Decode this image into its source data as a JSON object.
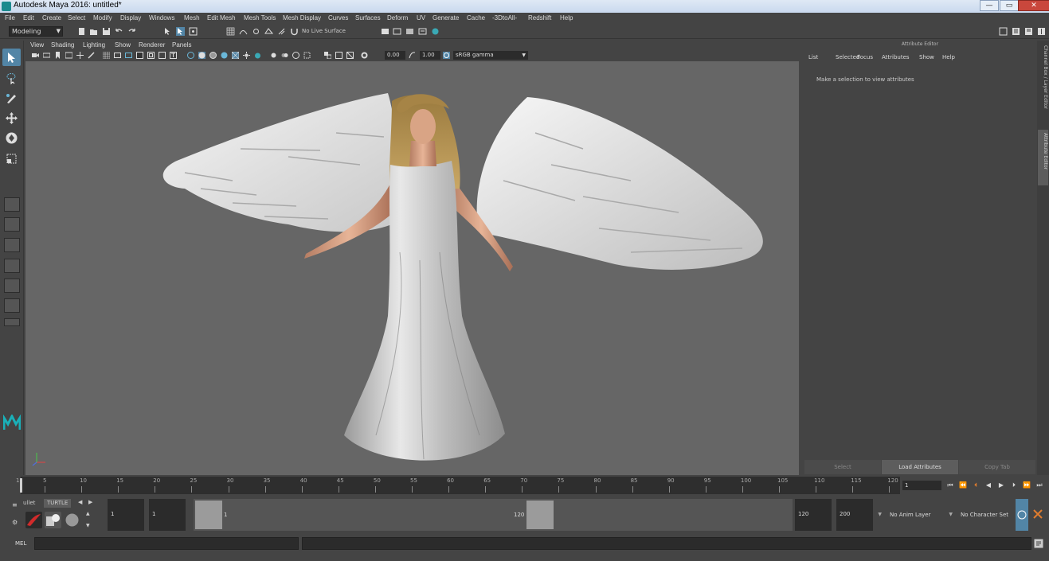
{
  "window": {
    "title": "Autodesk Maya 2016: untitled*"
  },
  "menubar": {
    "items": [
      "File",
      "Edit",
      "Create",
      "Select",
      "Modify",
      "Display",
      "Windows",
      "Mesh",
      "Edit Mesh",
      "Mesh Tools",
      "Mesh Display",
      "Curves",
      "Surfaces",
      "Deform",
      "UV",
      "Generate",
      "Cache",
      "-3DtoAll-",
      "Redshift",
      "Help"
    ]
  },
  "statusline": {
    "mode": "Modeling",
    "live_surface": "No Live Surface"
  },
  "viewport": {
    "menu": [
      "View",
      "Shading",
      "Lighting",
      "Show",
      "Renderer",
      "Panels"
    ],
    "exposure": "0.00",
    "gamma": "1.00",
    "color_space": "sRGB gamma"
  },
  "attribute_editor": {
    "title": "Attribute Editor",
    "menu": [
      "List",
      "Selected",
      "Focus",
      "Attributes",
      "Show",
      "Help"
    ],
    "message": "Make a selection to view attributes",
    "buttons": {
      "select": "Select",
      "load": "Load Attributes",
      "copy": "Copy Tab"
    },
    "side_tabs": {
      "channel_box": "Channel Box / Layer Editor",
      "attribute_editor": "Attribute Editor"
    }
  },
  "timeline": {
    "tick_labels": [
      "5",
      "10",
      "15",
      "20",
      "25",
      "30",
      "35",
      "40",
      "45",
      "50",
      "55",
      "60",
      "65",
      "70",
      "75",
      "80",
      "85",
      "90",
      "95",
      "100",
      "105",
      "110",
      "115",
      "120"
    ],
    "first_label": "1",
    "current_frame": "1"
  },
  "shelf": {
    "tabs": [
      "ullet",
      "TURTLE"
    ]
  },
  "range": {
    "start_time": "1",
    "playback_start": "1",
    "range_start_label": "1",
    "range_end_label": "120",
    "playback_end": "120",
    "end_time": "200",
    "anim_layer": "No Anim Layer",
    "character_set": "No Character Set"
  },
  "cmdline": {
    "label": "MEL"
  },
  "colors": {
    "accent": "#5285a6",
    "viewport_bg": "#666666",
    "panel_bg": "#444444"
  }
}
